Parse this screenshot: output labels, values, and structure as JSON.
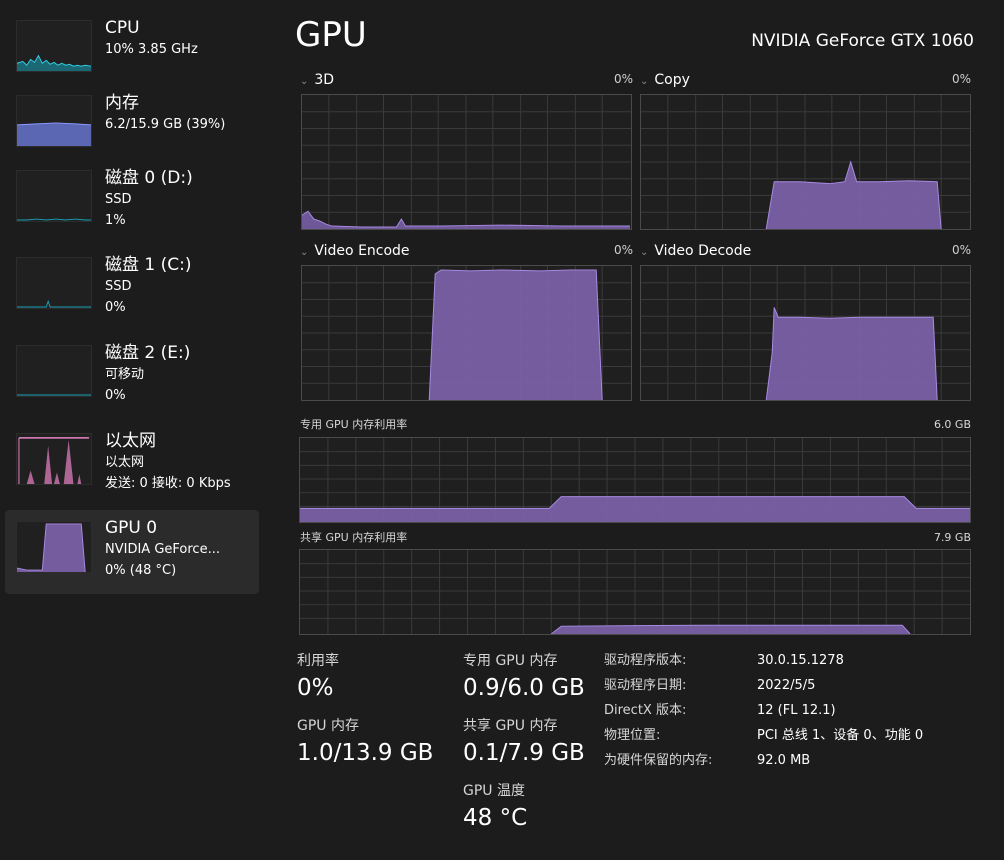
{
  "sidebar": {
    "items": [
      {
        "title": "CPU",
        "lines": [
          "10% 3.85 GHz"
        ],
        "graph_color": "#17a2b8"
      },
      {
        "title": "内存",
        "lines": [
          "6.2/15.9 GB (39%)"
        ],
        "graph_color": "#6b79d8"
      },
      {
        "title": "磁盘 0 (D:)",
        "lines": [
          "SSD",
          "1%"
        ],
        "graph_color": "#17a2b8"
      },
      {
        "title": "磁盘 1 (C:)",
        "lines": [
          "SSD",
          "0%"
        ],
        "graph_color": "#17a2b8"
      },
      {
        "title": "磁盘 2 (E:)",
        "lines": [
          "可移动",
          "0%"
        ],
        "graph_color": "#17a2b8"
      },
      {
        "title": "以太网",
        "lines": [
          "以太网",
          "发送: 0 接收: 0 Kbps"
        ],
        "graph_color": "#e883c6"
      },
      {
        "title": "GPU 0",
        "lines": [
          "NVIDIA GeForce...",
          "0% (48 °C)"
        ],
        "graph_color": "#9b7fd0"
      }
    ]
  },
  "main": {
    "title": "GPU",
    "gpu_name": "NVIDIA GeForce GTX 1060",
    "engines": [
      {
        "label": "3D",
        "pct": "0%"
      },
      {
        "label": "Copy",
        "pct": "0%"
      },
      {
        "label": "Video Encode",
        "pct": "0%"
      },
      {
        "label": "Video Decode",
        "pct": "0%"
      }
    ],
    "dedicated": {
      "label": "专用 GPU 内存利用率",
      "max": "6.0 GB"
    },
    "shared": {
      "label": "共享 GPU 内存利用率",
      "max": "7.9 GB"
    }
  },
  "stats": {
    "utilization": {
      "label": "利用率",
      "value": "0%"
    },
    "dedicated_mem": {
      "label": "专用 GPU 内存",
      "value": "0.9/6.0 GB"
    },
    "gpu_mem": {
      "label": "GPU 内存",
      "value": "1.0/13.9 GB"
    },
    "shared_mem": {
      "label": "共享 GPU 内存",
      "value": "0.1/7.9 GB"
    },
    "temperature": {
      "label": "GPU 温度",
      "value": "48 °C"
    }
  },
  "info": [
    {
      "key": "驱动程序版本:",
      "value": "30.0.15.1278"
    },
    {
      "key": "驱动程序日期:",
      "value": "2022/5/5"
    },
    {
      "key": "DirectX 版本:",
      "value": "12 (FL 12.1)"
    },
    {
      "key": "物理位置:",
      "value": "PCI 总线 1、设备 0、功能 0"
    },
    {
      "key": "为硬件保留的内存:",
      "value": "92.0 MB"
    }
  ],
  "colors": {
    "gpu_fill": "#7d63ad",
    "gpu_line": "#a88ae0",
    "cpu": "#17a2b8",
    "memory": "#6b79d8",
    "ethernet": "#e883c6",
    "grid": "#3a3a3a"
  }
}
